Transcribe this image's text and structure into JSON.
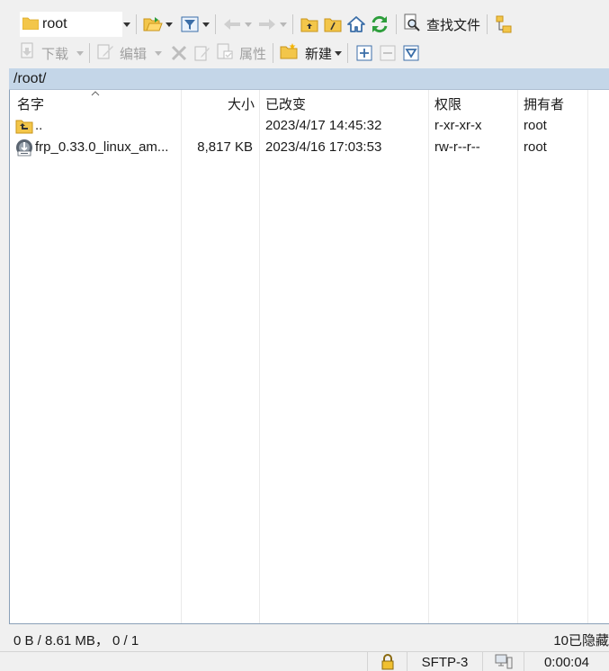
{
  "toolbar1": {
    "path_combo_value": "root",
    "find_files_label": "查找文件"
  },
  "toolbar2": {
    "download_label": "下载",
    "edit_label": "编辑",
    "properties_label": "属性",
    "new_label": "新建"
  },
  "path": "/root/",
  "columns": {
    "name": "名字",
    "size": "大小",
    "modified": "已改变",
    "permissions": "权限",
    "owner": "拥有者"
  },
  "files": [
    {
      "name": "..",
      "size": "",
      "modified": "2023/4/17 14:45:32",
      "permissions": "r-xr-xr-x",
      "owner": "root",
      "icon": "parent-folder-icon"
    },
    {
      "name": "frp_0.33.0_linux_am...",
      "size": "8,817 KB",
      "modified": "2023/4/16 17:03:53",
      "permissions": "rw-r--r--",
      "owner": "root",
      "icon": "gz-archive-icon"
    }
  ],
  "status": {
    "summary": "0 B / 8.61 MB，  0 / 1",
    "hidden": "10已隐藏"
  },
  "bottom": {
    "protocol": "SFTP-3",
    "elapsed": "0:00:04"
  },
  "colors": {
    "pathbar_bg": "#c4d6e8",
    "accent_green": "#2e9e3c",
    "folder_yellow": "#f3c64a"
  }
}
